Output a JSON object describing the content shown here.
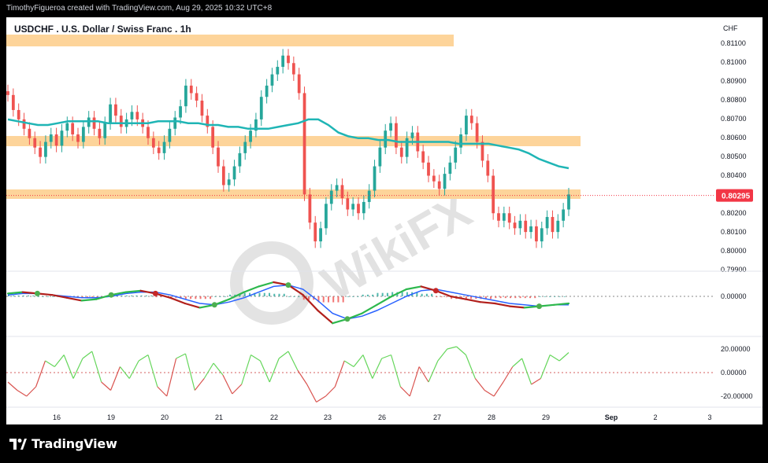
{
  "header": {
    "credit": "TimothyFigueroa created with TradingView.com, Aug 29, 2025 10:32 UTC+8"
  },
  "chart_title": "USDCHF . U.S. Dollar / Swiss Franc . 1h",
  "currency_label": "CHF",
  "brand": {
    "name": "TradingView"
  },
  "watermark": "WikiFX",
  "colors": {
    "up": "#26a69a",
    "down": "#ef5350",
    "ma": "#1fb5b5",
    "zone": "#fdd49a",
    "price_tag": "#f23645",
    "osc_green": "#65d65b",
    "osc_red": "#d9534f"
  },
  "chart_data": [
    {
      "type": "candlestick",
      "title": "USDCHF . U.S. Dollar / Swiss Franc . 1h",
      "x_ticks": [
        "16",
        "19",
        "20",
        "21",
        "22",
        "23",
        "26",
        "27",
        "28",
        "29",
        "Sep",
        "2",
        "3"
      ],
      "y_ticks": [
        "0.81100",
        "0.81000",
        "0.80900",
        "0.80800",
        "0.80700",
        "0.80600",
        "0.80500",
        "0.80400",
        "0.80200",
        "0.80100",
        "0.80000",
        "0.79900"
      ],
      "ylim": [
        0.7988,
        0.8117
      ],
      "last_price": "0.80295",
      "series": [
        {
          "name": "Price",
          "close": [
            0.8083,
            0.8075,
            0.807,
            0.8065,
            0.806,
            0.8055,
            0.805,
            0.8058,
            0.8062,
            0.8056,
            0.8064,
            0.8068,
            0.8062,
            0.8058,
            0.8066,
            0.8071,
            0.8065,
            0.806,
            0.8068,
            0.8078,
            0.8072,
            0.8066,
            0.807,
            0.8074,
            0.807,
            0.8066,
            0.806,
            0.8055,
            0.8052,
            0.8058,
            0.8065,
            0.8071,
            0.8077,
            0.8088,
            0.8084,
            0.808,
            0.8072,
            0.8066,
            0.8055,
            0.8045,
            0.8035,
            0.8038,
            0.8045,
            0.8052,
            0.8058,
            0.8064,
            0.807,
            0.8082,
            0.8088,
            0.8094,
            0.8098,
            0.8104,
            0.81,
            0.8094,
            0.8084,
            0.803,
            0.8015,
            0.8005,
            0.8012,
            0.8025,
            0.8032,
            0.8035,
            0.8028,
            0.8022,
            0.8025,
            0.802,
            0.8026,
            0.8032,
            0.8045,
            0.8055,
            0.8064,
            0.8068,
            0.8055,
            0.805,
            0.806,
            0.8063,
            0.8053,
            0.8047,
            0.804,
            0.8037,
            0.8033,
            0.8041,
            0.8047,
            0.8055,
            0.8062,
            0.8072,
            0.8068,
            0.8058,
            0.8048,
            0.804,
            0.802,
            0.8016,
            0.802,
            0.8015,
            0.8012,
            0.8016,
            0.801,
            0.8013,
            0.8005,
            0.8012,
            0.8018,
            0.801,
            0.8016,
            0.8022,
            0.803
          ]
        },
        {
          "name": "MA",
          "values": [
            0.807,
            0.8069,
            0.8068,
            0.8067,
            0.8067,
            0.8068,
            0.8069,
            0.8069,
            0.8069,
            0.8069,
            0.8068,
            0.8068,
            0.8068,
            0.8068,
            0.8068,
            0.8069,
            0.8069,
            0.8069,
            0.8068,
            0.8068,
            0.8067,
            0.8067,
            0.8066,
            0.8066,
            0.8065,
            0.8065,
            0.8065,
            0.8066,
            0.8067,
            0.8068,
            0.807,
            0.807,
            0.8067,
            0.8063,
            0.8061,
            0.806,
            0.806,
            0.8059,
            0.8059,
            0.8058,
            0.8058,
            0.8058,
            0.8058,
            0.8058,
            0.8058,
            0.8057,
            0.8057,
            0.8057,
            0.8057,
            0.8056,
            0.8055,
            0.8054,
            0.8052,
            0.8049,
            0.8047,
            0.8045,
            0.8044
          ]
        }
      ]
    },
    {
      "type": "line",
      "title": "",
      "y_ticks": [
        "0.00000"
      ],
      "series": [
        {
          "name": "",
          "values": [
            0.2,
            0.3,
            0.2,
            0.1,
            -0.1,
            -0.3,
            -0.2,
            0.1,
            0.3,
            0.4,
            0.2,
            -0.1,
            -0.5,
            -0.8,
            -0.6,
            -0.2,
            0.3,
            0.7,
            1.0,
            0.8,
            0.1,
            -1.0,
            -1.9,
            -1.6,
            -1.2,
            -0.6,
            0.0,
            0.5,
            0.7,
            0.4,
            0.0,
            -0.2,
            -0.4,
            -0.5,
            -0.7,
            -0.8,
            -0.7,
            -0.6,
            -0.5
          ]
        },
        {
          "name": "",
          "values": [
            0.1,
            0.2,
            0.2,
            0.1,
            0.0,
            -0.1,
            -0.1,
            0.0,
            0.2,
            0.3,
            0.3,
            0.1,
            -0.2,
            -0.5,
            -0.6,
            -0.4,
            -0.1,
            0.3,
            0.7,
            0.8,
            0.5,
            -0.3,
            -1.2,
            -1.6,
            -1.4,
            -1.0,
            -0.5,
            0.0,
            0.4,
            0.5,
            0.3,
            0.1,
            -0.1,
            -0.3,
            -0.5,
            -0.6,
            -0.7,
            -0.6,
            -0.6
          ]
        }
      ]
    },
    {
      "type": "line",
      "title": "",
      "y_ticks": [
        "20.00000",
        "0.00000",
        "-20.00000"
      ],
      "ylim": [
        -27,
        27
      ],
      "series": [
        {
          "name": "",
          "values": [
            -8,
            -15,
            -20,
            -12,
            10,
            5,
            15,
            -5,
            12,
            18,
            -8,
            -15,
            5,
            -5,
            10,
            15,
            -12,
            -20,
            12,
            16,
            -15,
            -5,
            8,
            -2,
            -18,
            -10,
            15,
            10,
            -8,
            12,
            18,
            2,
            -10,
            -25,
            -20,
            -12,
            10,
            5,
            15,
            -5,
            12,
            15,
            -12,
            -20,
            5,
            -8,
            10,
            20,
            22,
            15,
            -5,
            -15,
            -20,
            -8,
            5,
            12,
            -10,
            -5,
            15,
            10,
            17
          ]
        }
      ]
    }
  ]
}
